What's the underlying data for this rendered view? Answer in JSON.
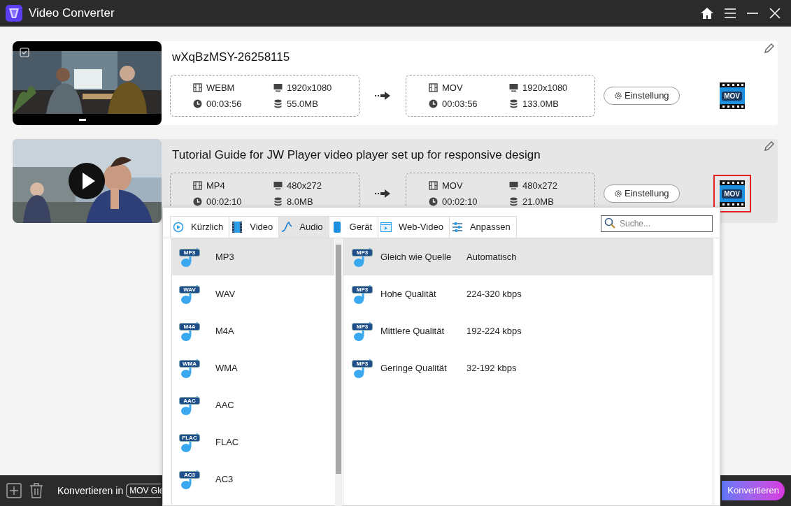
{
  "window": {
    "title": "Video Converter"
  },
  "tasks": [
    {
      "title": "wXqBzMSY-26258115",
      "selected": false,
      "thumbnail": {
        "kind": "picture",
        "checkbox": true
      },
      "source": {
        "format": "WEBM",
        "resolution": "1920x1080",
        "duration": "00:03:56",
        "size": "55.0MB"
      },
      "target": {
        "format": "MOV",
        "resolution": "1920x1080",
        "duration": "00:03:56",
        "size": "133.0MB"
      },
      "settings_button": "Einstellung",
      "output_badge": "MOV"
    },
    {
      "title": "Tutorial Guide for JW Player video player set up for responsive design",
      "selected": true,
      "thumbnail": {
        "kind": "picture",
        "play_button": true
      },
      "source": {
        "format": "MP4",
        "resolution": "480x272",
        "duration": "00:02:10",
        "size": "8.0MB"
      },
      "target": {
        "format": "MOV",
        "resolution": "480x272",
        "duration": "00:02:10",
        "size": "21.0MB"
      },
      "settings_button": "Einstellung",
      "output_badge": "MOV"
    }
  ],
  "format_popup": {
    "tabs": [
      {
        "label": "Kürzlich",
        "kind": "recent",
        "selected": false
      },
      {
        "label": "Video",
        "kind": "video",
        "selected": false
      },
      {
        "label": "Audio",
        "kind": "audio",
        "selected": true
      },
      {
        "label": "Gerät",
        "kind": "device",
        "selected": false
      },
      {
        "label": "Web-Video",
        "kind": "web",
        "selected": false
      },
      {
        "label": "Anpassen",
        "kind": "custom",
        "selected": false
      }
    ],
    "search": {
      "placeholder": "Suche..."
    },
    "formats": [
      {
        "badge": "MP3",
        "label": "MP3",
        "selected": true
      },
      {
        "badge": "WAV",
        "label": "WAV",
        "selected": false
      },
      {
        "badge": "M4A",
        "label": "M4A",
        "selected": false
      },
      {
        "badge": "WMA",
        "label": "WMA",
        "selected": false
      },
      {
        "badge": "AAC",
        "label": "AAC",
        "selected": false
      },
      {
        "badge": "FLAC",
        "label": "FLAC",
        "selected": false
      },
      {
        "badge": "AC3",
        "label": "AC3",
        "selected": false
      }
    ],
    "presets": [
      {
        "badge": "MP3",
        "name": "Gleich wie Quelle",
        "bitrate": "Automatisch",
        "selected": true
      },
      {
        "badge": "MP3",
        "name": "Hohe Qualität",
        "bitrate": "224-320 kbps",
        "selected": false
      },
      {
        "badge": "MP3",
        "name": "Mittlere Qualität",
        "bitrate": "192-224 kbps",
        "selected": false
      },
      {
        "badge": "MP3",
        "name": "Geringe Qualität",
        "bitrate": "32-192 kbps",
        "selected": false
      }
    ]
  },
  "bottom_bar": {
    "convert_to_label": "Konvertieren in",
    "convert_to_value": "MOV Gle",
    "convert_button": "Konvertieren"
  }
}
